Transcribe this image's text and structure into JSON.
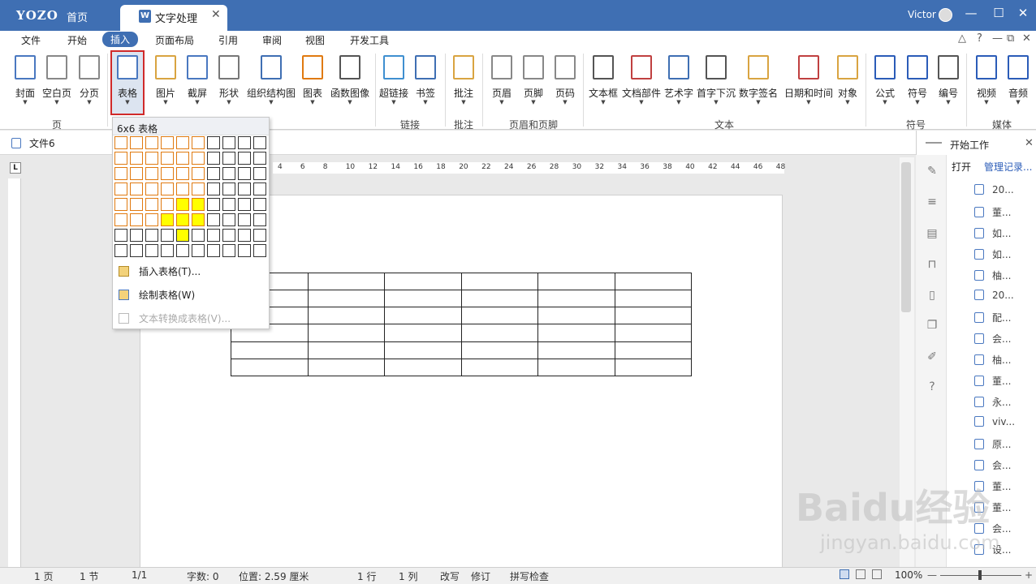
{
  "titlebar": {
    "logo": "YOZO",
    "home_tab": "首页",
    "doc_tab": "文字处理",
    "doc_tab_badge": "W",
    "user": "Victor"
  },
  "menubar": {
    "items": [
      "文件",
      "开始",
      "插入",
      "页面布局",
      "引用",
      "审阅",
      "视图",
      "开发工具"
    ],
    "active": "插入"
  },
  "ribbon": {
    "buttons": [
      {
        "label": "封面",
        "icon": "cover-icon"
      },
      {
        "label": "空白页",
        "icon": "blank-page-icon"
      },
      {
        "label": "分页",
        "icon": "page-break-icon"
      },
      {
        "label": "表格",
        "icon": "table-icon"
      },
      {
        "label": "图片",
        "icon": "picture-icon"
      },
      {
        "label": "截屏",
        "icon": "screenshot-icon"
      },
      {
        "label": "形状",
        "icon": "shapes-icon"
      },
      {
        "label": "组织结构图",
        "icon": "org-chart-icon"
      },
      {
        "label": "图表",
        "icon": "chart-icon"
      },
      {
        "label": "函数图像",
        "icon": "function-graph-icon"
      },
      {
        "label": "超链接",
        "icon": "hyperlink-icon"
      },
      {
        "label": "书签",
        "icon": "bookmark-icon"
      },
      {
        "label": "批注",
        "icon": "comment-icon"
      },
      {
        "label": "页眉",
        "icon": "header-icon"
      },
      {
        "label": "页脚",
        "icon": "footer-icon"
      },
      {
        "label": "页码",
        "icon": "page-number-icon"
      },
      {
        "label": "文本框",
        "icon": "textbox-icon"
      },
      {
        "label": "文档部件",
        "icon": "doc-parts-icon"
      },
      {
        "label": "艺术字",
        "icon": "wordart-icon"
      },
      {
        "label": "首字下沉",
        "icon": "drop-cap-icon"
      },
      {
        "label": "数字签名",
        "icon": "signature-icon"
      },
      {
        "label": "日期和时间",
        "icon": "datetime-icon"
      },
      {
        "label": "对象",
        "icon": "object-icon"
      },
      {
        "label": "公式",
        "icon": "formula-icon"
      },
      {
        "label": "符号",
        "icon": "symbol-icon"
      },
      {
        "label": "编号",
        "icon": "numbering-icon"
      },
      {
        "label": "视频",
        "icon": "video-icon"
      },
      {
        "label": "音频",
        "icon": "audio-icon"
      }
    ],
    "groups": [
      "页",
      "链接",
      "批注",
      "页眉和页脚",
      "文本",
      "符号",
      "媒体"
    ]
  },
  "doc": {
    "tab": "文件6",
    "ruler_corner": "L",
    "ruler_labels": [
      "4",
      "6",
      "8",
      "10",
      "12",
      "14",
      "16",
      "18",
      "20",
      "22",
      "24",
      "26",
      "28",
      "30",
      "32",
      "34",
      "36",
      "38",
      "40",
      "42",
      "44",
      "46",
      "48"
    ]
  },
  "table_dropdown": {
    "size_label": "6x6 表格",
    "items": [
      {
        "label": "插入表格(T)...",
        "enabled": true
      },
      {
        "label": "绘制表格(W)",
        "enabled": true
      },
      {
        "label": "文本转换成表格(V)...",
        "enabled": false
      }
    ],
    "grid": {
      "cols": 10,
      "rows": 8,
      "selected_cols": 6,
      "selected_rows": 6
    }
  },
  "right_panel": {
    "title": "开始工作",
    "open": "打开",
    "manage": "管理记录...",
    "files": [
      "20...",
      "董...",
      "如...",
      "如...",
      "柚...",
      "20...",
      "配...",
      "会...",
      "柚...",
      "董...",
      "永...",
      "viv...",
      "原...",
      "会...",
      "董...",
      "董...",
      "会...",
      "设..."
    ]
  },
  "status": {
    "page": "1 页",
    "section": "1 节",
    "pages": "1/1",
    "words": "字数: 0",
    "position": "位置: 2.59 厘米",
    "line": "1 行",
    "column": "1 列",
    "overwrite": "改写",
    "track": "修订",
    "spell": "拼写检查",
    "zoom": "100%"
  },
  "watermark": {
    "line1": "Baidu经验",
    "line2": "jingyan.baidu.com"
  }
}
